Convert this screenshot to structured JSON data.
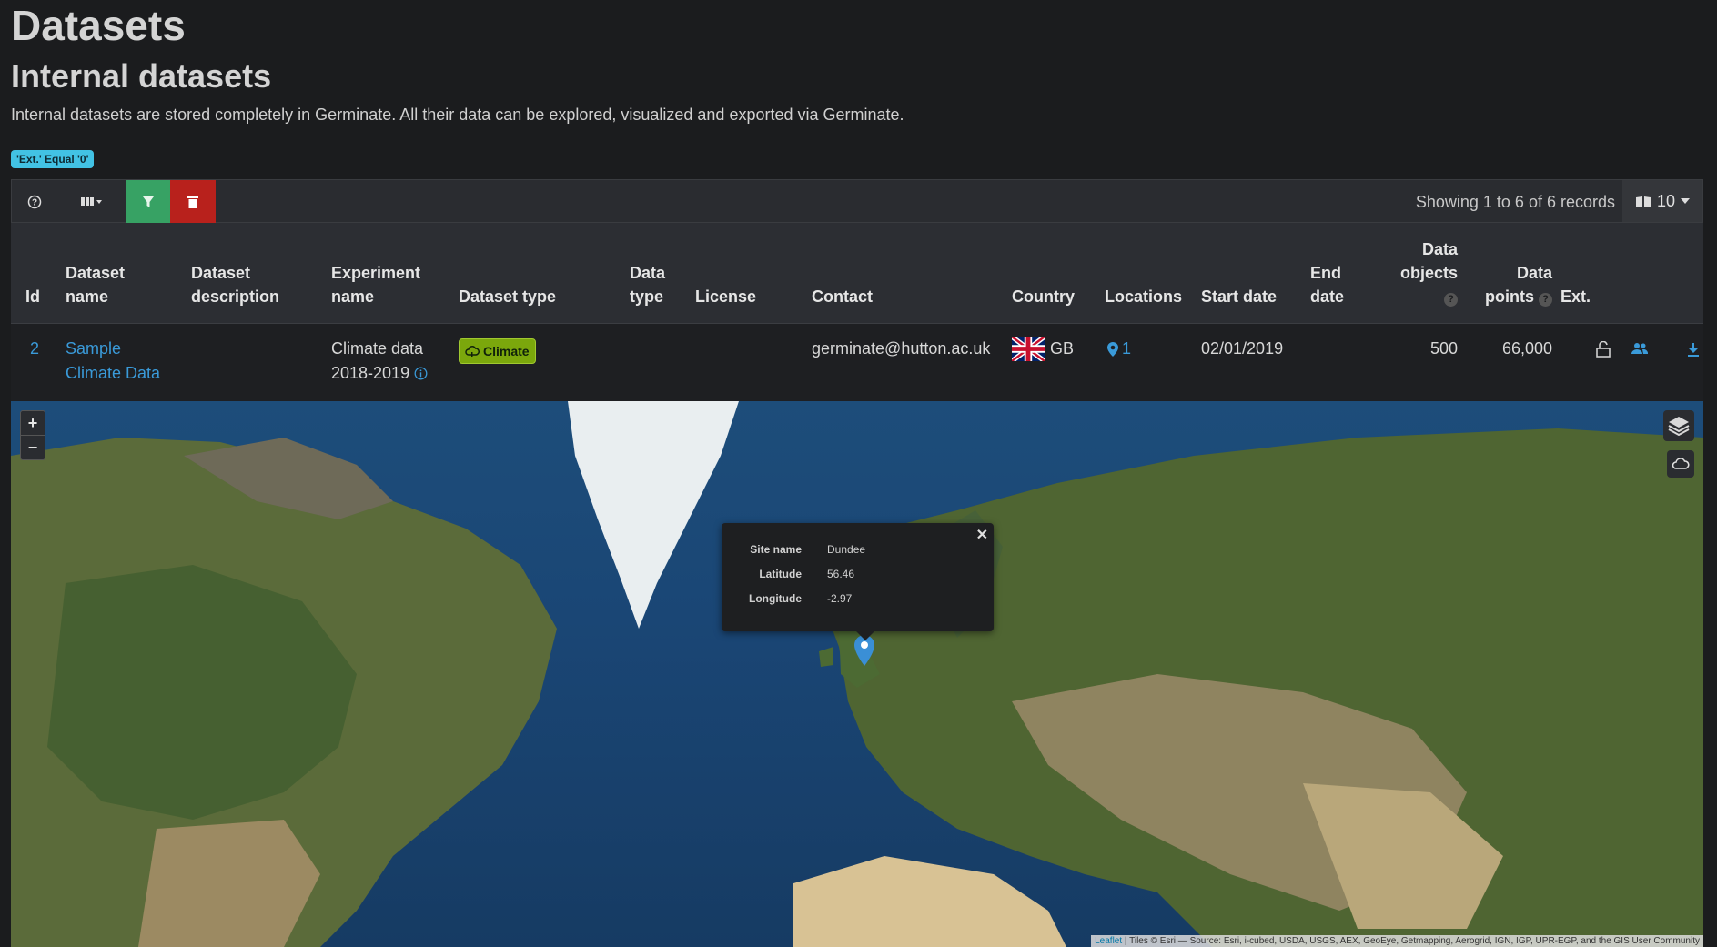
{
  "page": {
    "title": "Datasets",
    "subtitle": "Internal datasets",
    "description": "Internal datasets are stored completely in Germinate. All their data can be explored, visualized and exported via Germinate.",
    "filter_badge": "'Ext.' Equal '0'"
  },
  "toolbar": {
    "help_icon": "question-circle-icon",
    "columns_icon": "columns-icon",
    "filter_icon": "filter-icon",
    "delete_icon": "trash-icon",
    "records_text": "Showing 1 to 6 of 6 records",
    "page_size": "10"
  },
  "table": {
    "headers": {
      "id": "Id",
      "dataset_name_1": "Dataset",
      "dataset_name_2": "name",
      "dataset_desc_1": "Dataset",
      "dataset_desc_2": "description",
      "experiment_1": "Experiment",
      "experiment_2": "name",
      "dataset_type": "Dataset type",
      "data_type_1": "Data",
      "data_type_2": "type",
      "license": "License",
      "contact": "Contact",
      "country": "Country",
      "locations": "Locations",
      "start_date": "Start date",
      "end_date_1": "End",
      "end_date_2": "date",
      "data_objects_1": "Data",
      "data_objects_2": "objects",
      "data_points_1": "Data",
      "data_points_2": "points",
      "ext": "Ext."
    },
    "rows": [
      {
        "id": "2",
        "name_1": "Sample",
        "name_2": "Climate Data",
        "experiment_1": "Climate data",
        "experiment_2": "2018-2019",
        "dataset_type": "Climate",
        "contact": "germinate@hutton.ac.uk",
        "country": "GB",
        "locations": "1",
        "start_date": "02/01/2019",
        "data_objects": "500",
        "data_points": "66,000"
      }
    ]
  },
  "map": {
    "popup": {
      "site_label": "Site name",
      "site_value": "Dundee",
      "lat_label": "Latitude",
      "lat_value": "56.46",
      "lon_label": "Longitude",
      "lon_value": "-2.97"
    },
    "zoom_in": "+",
    "zoom_out": "−",
    "attribution_link": "Leaflet",
    "attribution_text": " | Tiles © Esri — Source: Esri, i-cubed, USDA, USGS, AEX, GeoEye, Getmapping, Aerogrid, IGN, IGP, UPR-EGP, and the GIS User Community"
  },
  "colors": {
    "link": "#3a9ad9",
    "filter_button": "#37a264",
    "delete_button": "#b8211c",
    "climate_badge": "#7ba70c",
    "filter_badge": "#42c2e4"
  }
}
